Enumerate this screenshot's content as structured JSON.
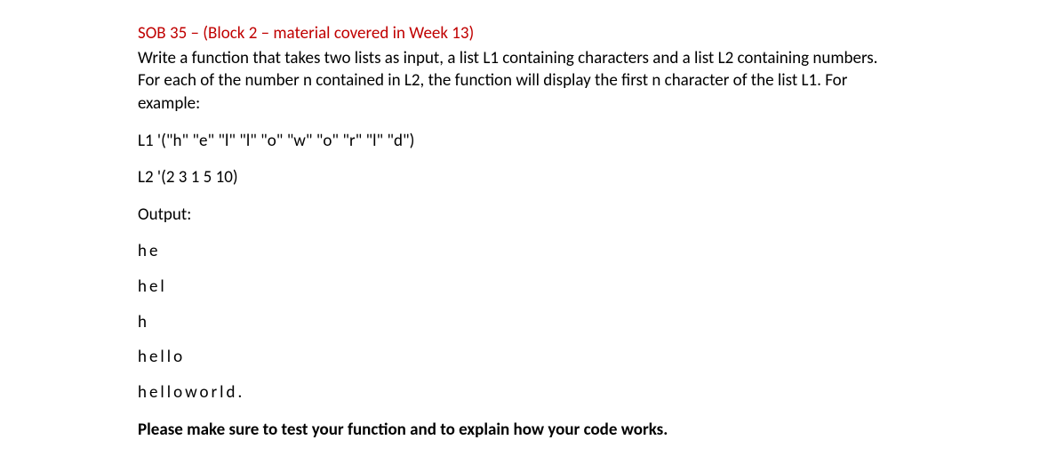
{
  "title": "SOB 35 – (Block 2 – material covered in Week 13)",
  "description": "Write a function that takes two lists as input, a list L1 containing characters and a list L2 containing numbers. For each of the number n contained in L2, the function will display the first n character of the list L1. For example:",
  "l1": "L1 '(\"h\" \"e\" \"l\" \"l\" \"o\" \"w\" \"o\" \"r\" \"l\" \"d\")",
  "l2": "L2 '(2 3 1 5 10)",
  "output_label": "Output:",
  "outputs": {
    "o1": "he",
    "o2": "hel",
    "o3": "h",
    "o4": "hello",
    "o5": "helloworld."
  },
  "note": "Please make sure to test your function and to explain how your code works."
}
